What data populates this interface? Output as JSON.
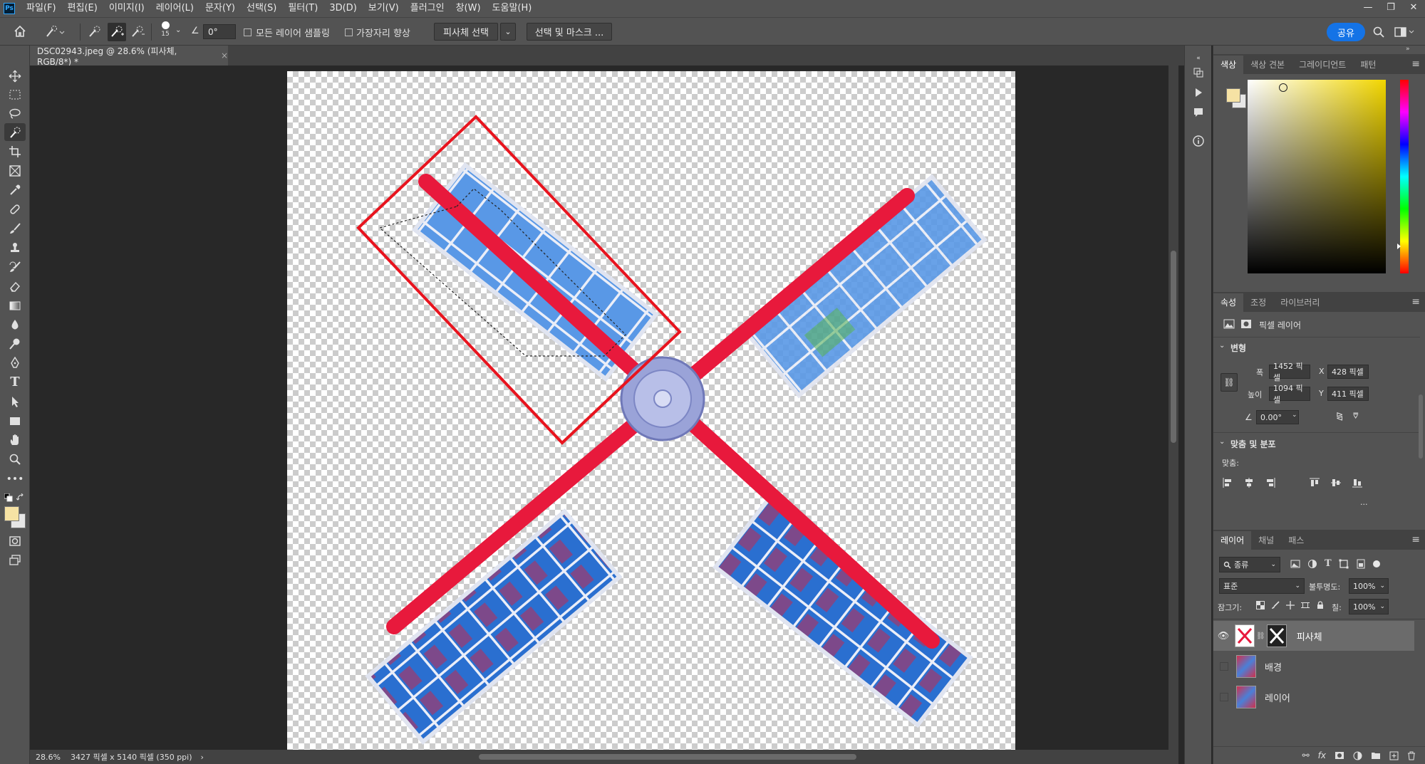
{
  "app": {
    "logo": "Ps"
  },
  "menu": [
    "파일(F)",
    "편집(E)",
    "이미지(I)",
    "레이어(L)",
    "문자(Y)",
    "선택(S)",
    "필터(T)",
    "3D(D)",
    "보기(V)",
    "플러그인",
    "창(W)",
    "도움말(H)"
  ],
  "window_controls": {
    "minimize": "—",
    "restore": "❐",
    "close": "✕"
  },
  "options": {
    "brush_size": "15",
    "angle": "0°",
    "sample_all_layers": "모든 레이어 샘플링",
    "enhance_edge": "가장자리 향상",
    "select_subject": "피사체 선택",
    "select_and_mask": "선택 및 마스크 ...",
    "share": "공유"
  },
  "document": {
    "tab_title": "DSC02943.jpeg @ 28.6% (피사체, RGB/8*) *",
    "close": "×"
  },
  "status": {
    "zoom": "28.6%",
    "doc_info": "3427 픽셀 x 5140 픽셀 (350 ppi)",
    "arrow": "›"
  },
  "color_panel": {
    "tabs": [
      "색상",
      "색상 견본",
      "그레이디언트",
      "패턴"
    ],
    "foreground": "#f6e2a4",
    "background": "#e6e6e6",
    "picker_hue": "#f2d600"
  },
  "properties": {
    "tabs": [
      "속성",
      "조정",
      "라이브러리"
    ],
    "kind": "픽셀 레이어",
    "transform_title": "변형",
    "w_label": "폭",
    "w_value": "1452 픽셀",
    "x_label": "X",
    "x_value": "428 픽셀",
    "h_label": "높이",
    "h_value": "1094 픽셀",
    "y_label": "Y",
    "y_value": "411 픽셀",
    "angle_value": "0.00°",
    "align_title": "맞춤 및 분포",
    "align_label": "맞춤:",
    "more": "···"
  },
  "layers_panel": {
    "tabs": [
      "레이어",
      "채널",
      "패스"
    ],
    "filter": "종류",
    "blend_mode": "표준",
    "opacity_label": "불투명도:",
    "opacity_value": "100%",
    "lock_label": "잠그기:",
    "fill_label": "칠:",
    "fill_value": "100%",
    "layers": [
      {
        "name": "피사체",
        "visible": true,
        "selected": true
      },
      {
        "name": "배경",
        "visible": false,
        "selected": false
      },
      {
        "name": "레이어",
        "visible": false,
        "selected": false
      }
    ]
  },
  "colors": {
    "accent": "#1473e6",
    "annotation": "#e8141e",
    "windmill": "#e8193c"
  }
}
